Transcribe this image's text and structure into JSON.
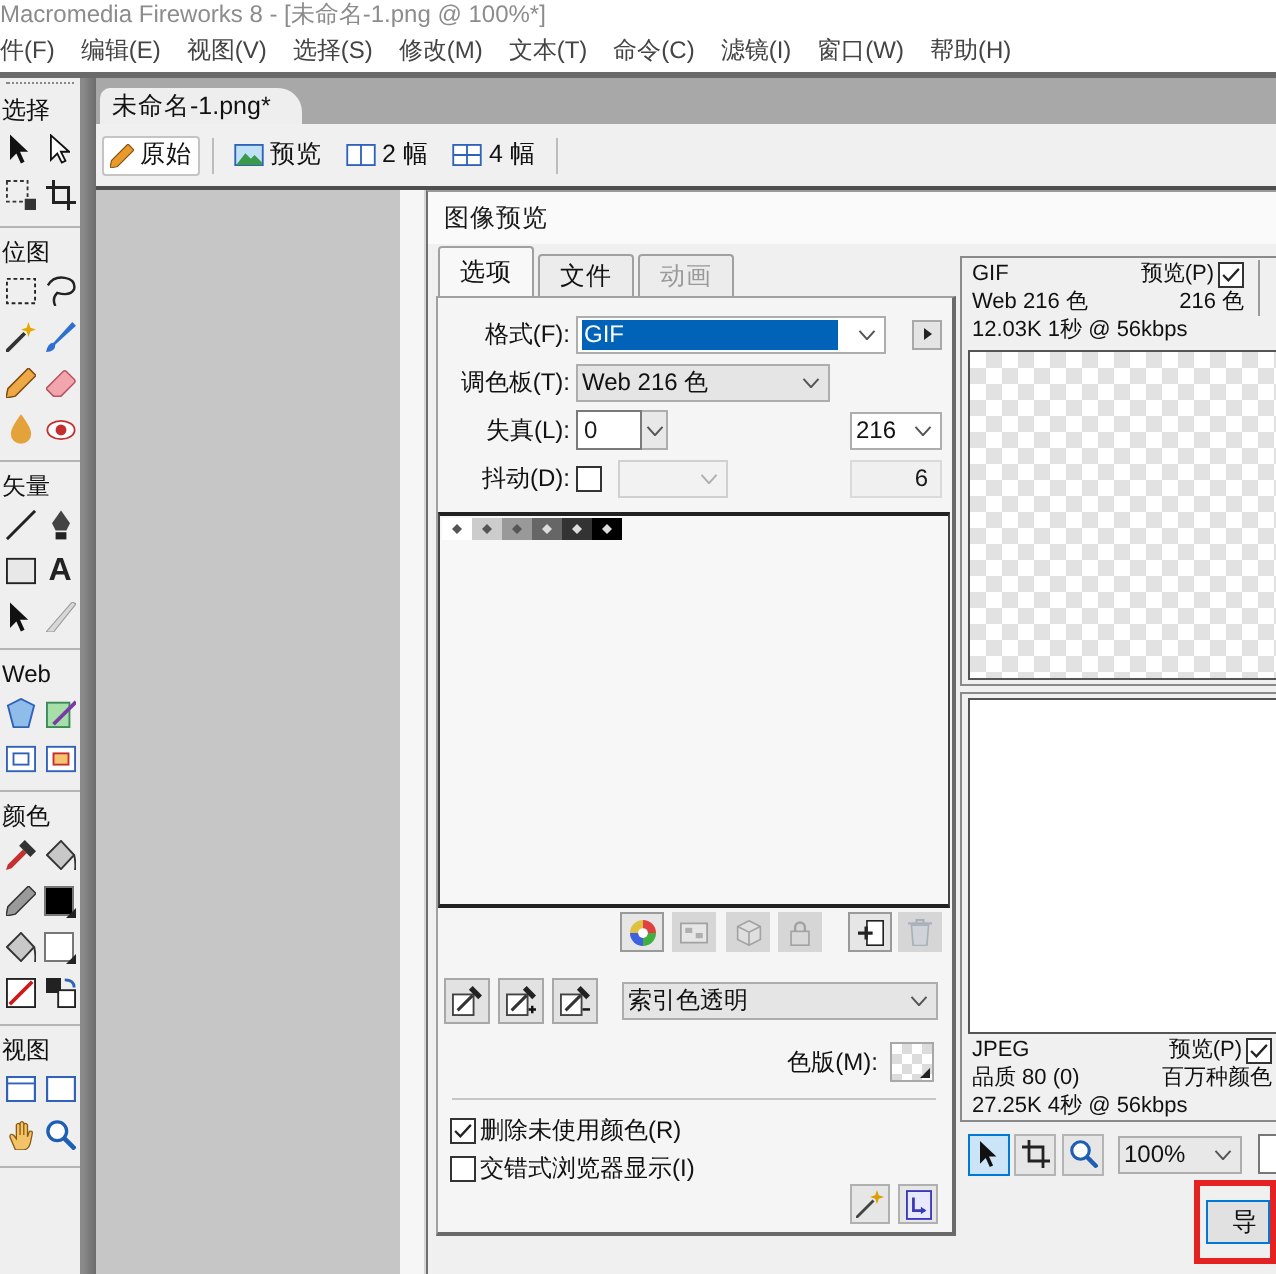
{
  "window": {
    "title": "Macromedia Fireworks 8 - [未命名-1.png @ 100%*]"
  },
  "menu_bar": [
    "件(F)",
    "编辑(E)",
    "视图(V)",
    "选择(S)",
    "修改(M)",
    "文本(T)",
    "命令(C)",
    "滤镜(I)",
    "窗口(W)",
    "帮助(H)"
  ],
  "tools_panel": {
    "sections": [
      {
        "title": "选择"
      },
      {
        "title": "位图"
      },
      {
        "title": "矢量",
        "text_tool": "A"
      },
      {
        "title": "Web"
      },
      {
        "title": "颜色",
        "swatches": [
          {
            "color": "#000000"
          },
          {
            "color": "#ffffff"
          }
        ]
      },
      {
        "title": "视图"
      }
    ]
  },
  "document": {
    "tab": {
      "label": "未命名-1.png*"
    },
    "view_tabs": [
      {
        "label": "原始",
        "selected": true
      },
      {
        "label": "预览",
        "selected": false
      },
      {
        "label": "2 幅",
        "selected": false
      },
      {
        "label": "4 幅",
        "selected": false
      }
    ]
  },
  "dialog": {
    "title": "图像预览",
    "tabs": [
      {
        "label": "选项",
        "selected": true,
        "disabled": false
      },
      {
        "label": "文件",
        "selected": false,
        "disabled": false
      },
      {
        "label": "动画",
        "selected": false,
        "disabled": true
      }
    ],
    "format": {
      "label": "格式(F):",
      "value": "GIF",
      "focused": true
    },
    "palette": {
      "label": "调色板(T):",
      "value": "Web 216 色"
    },
    "loss": {
      "label": "失真(L):",
      "value": "0"
    },
    "max_colors": {
      "value": "216"
    },
    "dither": {
      "label": "抖动(D):",
      "checked": false
    },
    "color_count": "6",
    "swatches": [
      {
        "color": "#ffffff"
      },
      {
        "color": "#cccccc"
      },
      {
        "color": "#999999"
      },
      {
        "color": "#666666"
      },
      {
        "color": "#333333"
      },
      {
        "color": "#000000"
      }
    ],
    "palette_buttons": [
      {
        "disabled": false
      },
      {
        "disabled": true
      },
      {
        "disabled": true
      },
      {
        "disabled": true
      },
      {
        "disabled": false
      },
      {
        "disabled": true
      }
    ],
    "transparency": {
      "value": "索引色透明"
    },
    "matte": {
      "label": "色版(M):"
    },
    "options": [
      {
        "label": "删除未使用颜色(R)",
        "checked": true
      },
      {
        "label": "交错式浏览器显示(I)",
        "checked": false
      }
    ],
    "previews": [
      {
        "kind": "checkerboard",
        "format": "GIF",
        "settings": "Web 216 色",
        "stats": "12.03K 1秒 @ 56kbps",
        "preview_label": "预览(P)",
        "preview": true,
        "colors": "216 色"
      },
      {
        "kind": "blank",
        "format": "JPEG",
        "settings": "品质 80 (0)",
        "stats": "27.25K 4秒 @ 56kbps",
        "preview_label": "预览(P)",
        "preview": true,
        "colors": "百万种颜色"
      }
    ],
    "preview_tools": [
      {
        "selected": true
      },
      {
        "selected": false
      },
      {
        "selected": false
      }
    ],
    "zoom": {
      "value": "100%"
    },
    "export_button": {
      "label": "导",
      "highlighted": true
    }
  }
}
